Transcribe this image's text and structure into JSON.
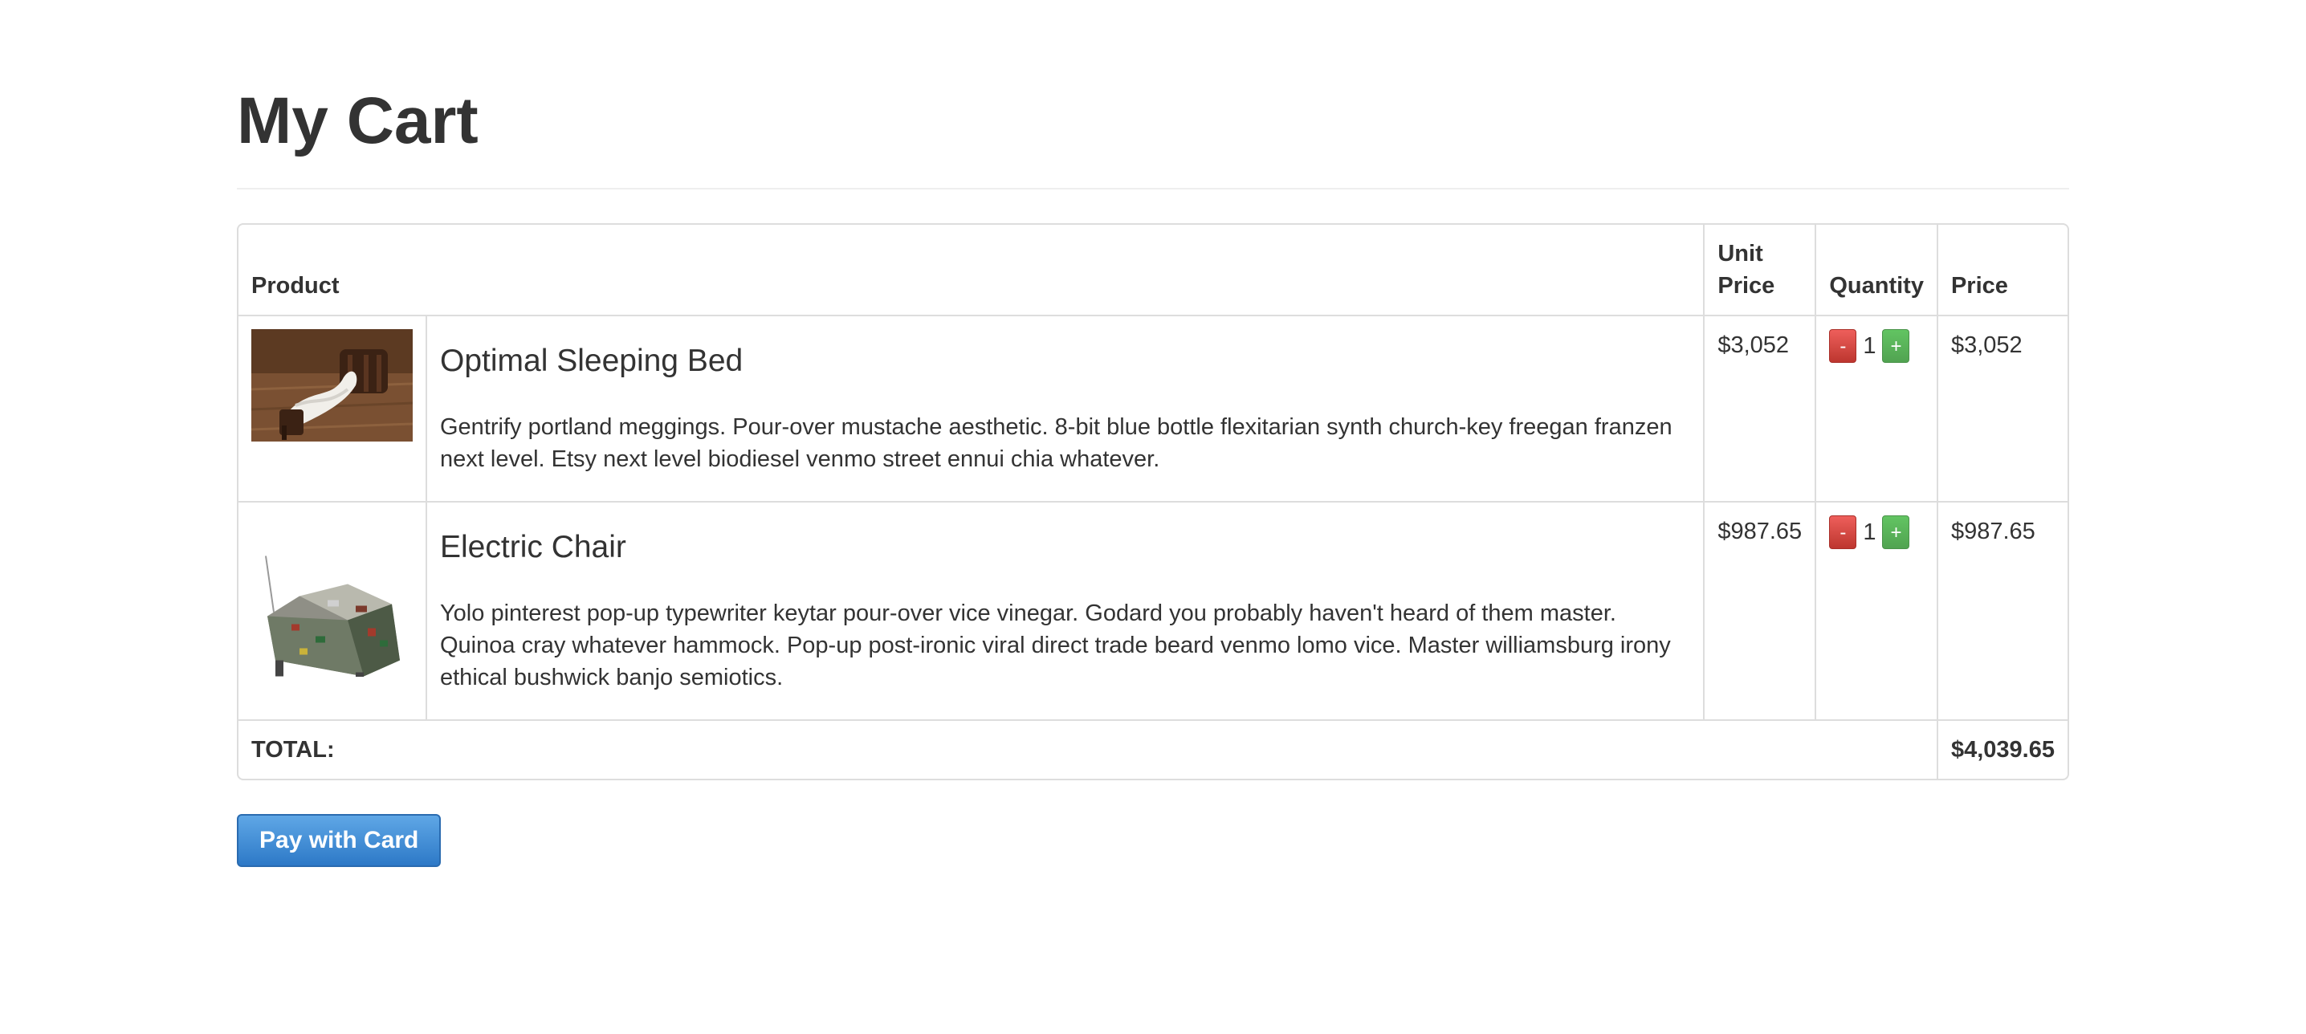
{
  "page": {
    "title": "My Cart"
  },
  "table": {
    "headers": {
      "product": "Product",
      "unit_price": "Unit Price",
      "quantity": "Quantity",
      "price": "Price"
    },
    "items": [
      {
        "name": "Optimal Sleeping Bed",
        "description": "Gentrify portland meggings. Pour-over mustache aesthetic. 8-bit blue bottle flexitarian synth church-key freegan franzen next level. Etsy next level biodiesel venmo street ennui chia whatever.",
        "unit_price": "$3,052",
        "quantity": "1",
        "price": "$3,052",
        "image": "bed-photo"
      },
      {
        "name": "Electric Chair",
        "description": "Yolo pinterest pop-up typewriter keytar pour-over vice vinegar. Godard you probably haven't heard of them master. Quinoa cray whatever hammock. Pop-up post-ironic viral direct trade beard venmo lomo vice. Master williamsburg irony ethical bushwick banjo semiotics.",
        "unit_price": "$987.65",
        "quantity": "1",
        "price": "$987.65",
        "image": "chair-photo"
      }
    ],
    "total_label": "TOTAL:",
    "total_value": "$4,039.65",
    "minus_label": "-",
    "plus_label": "+"
  },
  "actions": {
    "pay_label": "Pay with Card"
  },
  "colors": {
    "pay_button": "#3a8ad6",
    "minus_button": "#d9534f",
    "plus_button": "#5cb85c",
    "border": "#dddddd"
  }
}
